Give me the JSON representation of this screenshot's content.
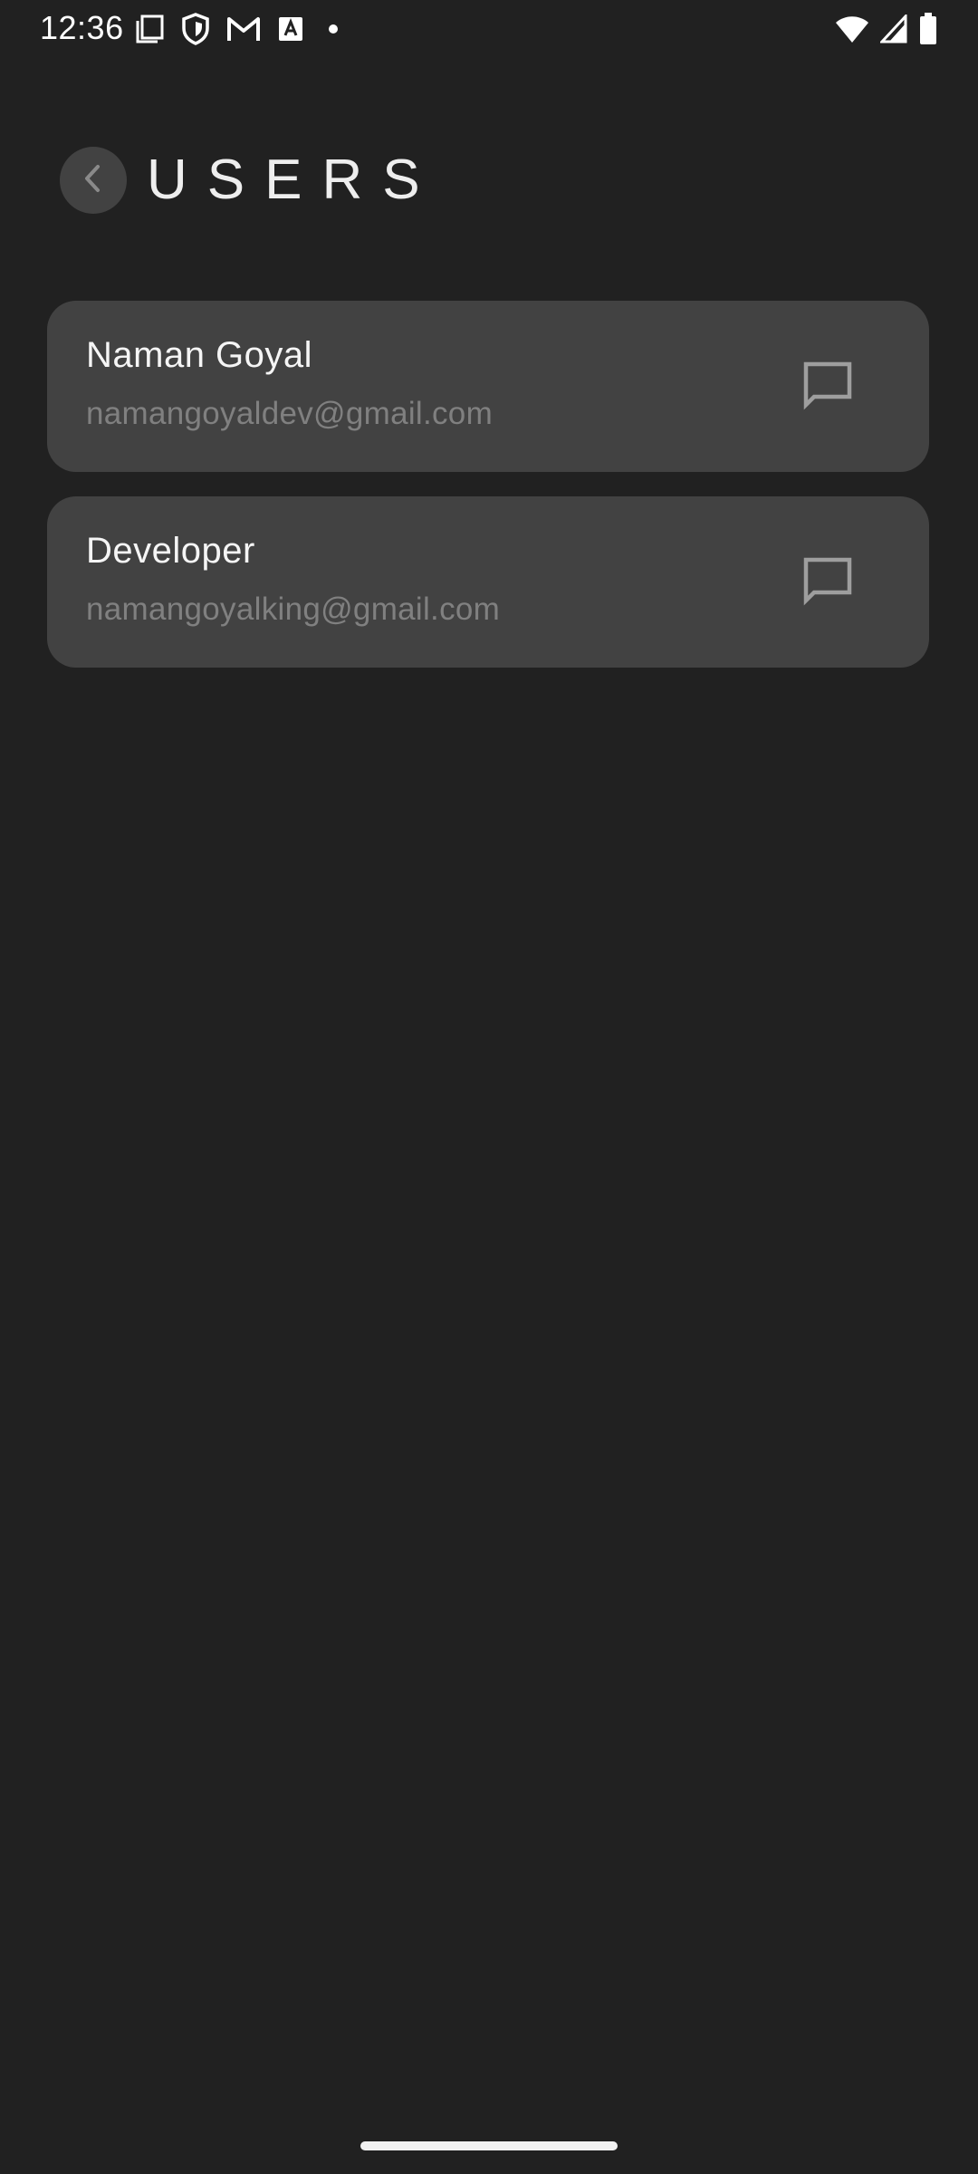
{
  "status_bar": {
    "time": "12:36",
    "left_icons": [
      "screenshot-icon",
      "shield-icon",
      "gmail-icon",
      "keyboard-a-icon",
      "dot-icon"
    ],
    "right_icons": [
      "wifi-icon",
      "signal-icon",
      "battery-icon"
    ]
  },
  "header": {
    "back_icon": "chevron-left-icon",
    "title": "USERS"
  },
  "users": [
    {
      "name": "Naman Goyal",
      "email": "namangoyaldev@gmail.com",
      "action_icon": "chat-bubble-icon"
    },
    {
      "name": "Developer",
      "email": "namangoyalking@gmail.com",
      "action_icon": "chat-bubble-icon"
    }
  ],
  "colors": {
    "background": "#212121",
    "card": "#424242",
    "back_button": "#424242",
    "primary_text": "#f5f5f5",
    "secondary_text": "#808080"
  }
}
